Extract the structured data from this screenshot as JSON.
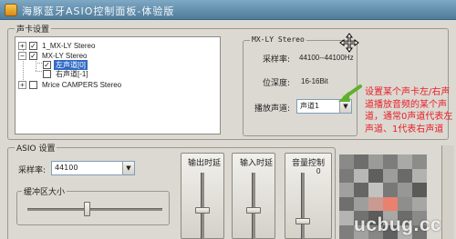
{
  "window": {
    "title": "海豚蓝牙ASIO控制面板-体验版"
  },
  "sound_card_group": {
    "title": "声卡设置",
    "tree": [
      {
        "label": "1_MX-LY Stereo",
        "expanded": false,
        "checked": true
      },
      {
        "label": "MX-LY Stereo",
        "expanded": true,
        "checked": true
      },
      {
        "label": "左声道[0]",
        "checked": true,
        "selected": true
      },
      {
        "label": "右声道[-1]",
        "checked": false
      },
      {
        "label": "Mrice CAMPERS Stereo",
        "expanded": false,
        "checked": false
      }
    ]
  },
  "device_panel": {
    "title": "MX-LY Stereo",
    "sample_rate_label": "采样率:",
    "sample_rate_value": "44100--44100Hz",
    "bit_depth_label": "位深度:",
    "bit_depth_value": "16-16Bit",
    "channel_label": "播放声道:",
    "channel_value": "声道1"
  },
  "annotation": {
    "text": "设置某个声卡左/右声道播放音频的某个声道，通常0声道代表左声道、1代表右声道",
    "color": "#e8202a"
  },
  "asio_group": {
    "title": "ASIO 设置",
    "sample_rate_label": "采样率:",
    "sample_rate_value": "44100",
    "buffer_label": "缓冲区大小",
    "output_latency_label": "输出时延",
    "input_latency_label": "输入时延",
    "volume_label": "音量控制",
    "volume_value": "0"
  },
  "watermark": {
    "text": "ucbug.cc"
  },
  "icons": [
    "app-icon",
    "move-cursor-icon",
    "arrow-icon",
    "checkbox-icon",
    "expander-icon",
    "chevron-down-icon"
  ]
}
